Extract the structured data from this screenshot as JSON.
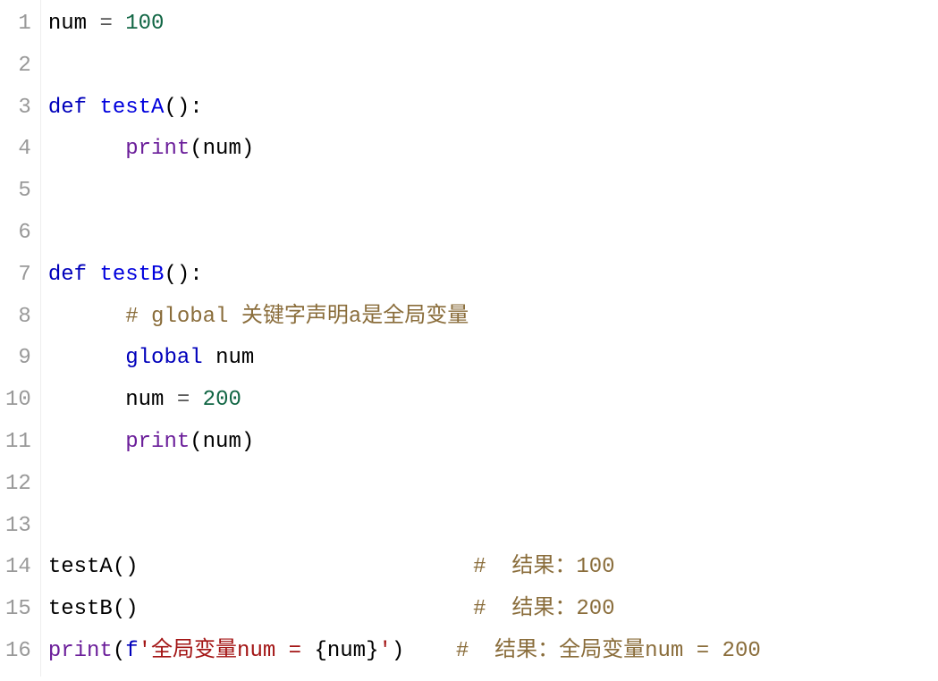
{
  "editor": {
    "gutter": [
      "1",
      "2",
      "3",
      "4",
      "5",
      "6",
      "7",
      "8",
      "9",
      "10",
      "11",
      "12",
      "13",
      "14",
      "15",
      "16"
    ],
    "lines": [
      [
        {
          "t": "num",
          "c": "name"
        },
        {
          "t": " ",
          "c": "text"
        },
        {
          "t": "=",
          "c": "op"
        },
        {
          "t": " ",
          "c": "text"
        },
        {
          "t": "100",
          "c": "num"
        }
      ],
      [],
      [
        {
          "t": "def",
          "c": "kw"
        },
        {
          "t": " ",
          "c": "text"
        },
        {
          "t": "testA",
          "c": "def"
        },
        {
          "t": "():",
          "c": "punct"
        }
      ],
      [
        {
          "t": "      ",
          "c": "text"
        },
        {
          "t": "print",
          "c": "builtin"
        },
        {
          "t": "(",
          "c": "punct"
        },
        {
          "t": "num",
          "c": "name"
        },
        {
          "t": ")",
          "c": "punct"
        }
      ],
      [],
      [],
      [
        {
          "t": "def",
          "c": "kw"
        },
        {
          "t": " ",
          "c": "text"
        },
        {
          "t": "testB",
          "c": "def"
        },
        {
          "t": "():",
          "c": "punct"
        }
      ],
      [
        {
          "t": "      ",
          "c": "text"
        },
        {
          "t": "# global 关键字声明a是全局变量",
          "c": "comment"
        }
      ],
      [
        {
          "t": "      ",
          "c": "text"
        },
        {
          "t": "global",
          "c": "kw"
        },
        {
          "t": " ",
          "c": "text"
        },
        {
          "t": "num",
          "c": "name"
        }
      ],
      [
        {
          "t": "      ",
          "c": "text"
        },
        {
          "t": "num",
          "c": "name"
        },
        {
          "t": " ",
          "c": "text"
        },
        {
          "t": "=",
          "c": "op"
        },
        {
          "t": " ",
          "c": "text"
        },
        {
          "t": "200",
          "c": "num"
        }
      ],
      [
        {
          "t": "      ",
          "c": "text"
        },
        {
          "t": "print",
          "c": "builtin"
        },
        {
          "t": "(",
          "c": "punct"
        },
        {
          "t": "num",
          "c": "name"
        },
        {
          "t": ")",
          "c": "punct"
        }
      ],
      [],
      [],
      [
        {
          "t": "testA",
          "c": "fn"
        },
        {
          "t": "()",
          "c": "punct"
        },
        {
          "t": "                          ",
          "c": "text"
        },
        {
          "t": "#  结果：100",
          "c": "comment"
        }
      ],
      [
        {
          "t": "testB",
          "c": "fn"
        },
        {
          "t": "()",
          "c": "punct"
        },
        {
          "t": "                          ",
          "c": "text"
        },
        {
          "t": "#  结果：200",
          "c": "comment"
        }
      ],
      [
        {
          "t": "print",
          "c": "builtin"
        },
        {
          "t": "(",
          "c": "punct"
        },
        {
          "t": "f",
          "c": "strpre"
        },
        {
          "t": "'全局变量num = ",
          "c": "str"
        },
        {
          "t": "{",
          "c": "punct"
        },
        {
          "t": "num",
          "c": "name"
        },
        {
          "t": "}",
          "c": "punct"
        },
        {
          "t": "'",
          "c": "str"
        },
        {
          "t": ")",
          "c": "punct"
        },
        {
          "t": "    ",
          "c": "text"
        },
        {
          "t": "#  结果：全局变量num = 200",
          "c": "comment"
        }
      ]
    ]
  }
}
